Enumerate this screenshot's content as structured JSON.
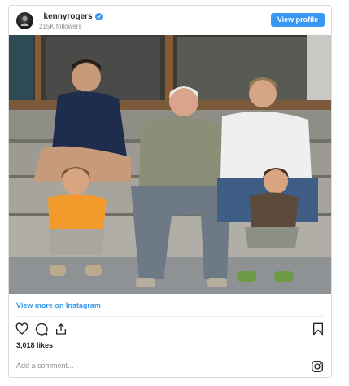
{
  "header": {
    "username": "_kennyrogers",
    "followers": "215K followers",
    "view_profile_label": "View profile"
  },
  "post": {
    "view_more_label": "View more on Instagram",
    "likes": "3,018 likes",
    "comment_placeholder": "Add a comment..."
  },
  "colors": {
    "accent": "#3897f0",
    "text": "#262626",
    "muted": "#8e8e8e",
    "border": "#dbdbdb"
  },
  "icons": [
    "avatar",
    "verified-badge-icon",
    "heart-icon",
    "comment-icon",
    "share-icon",
    "bookmark-icon",
    "instagram-logo-icon"
  ]
}
